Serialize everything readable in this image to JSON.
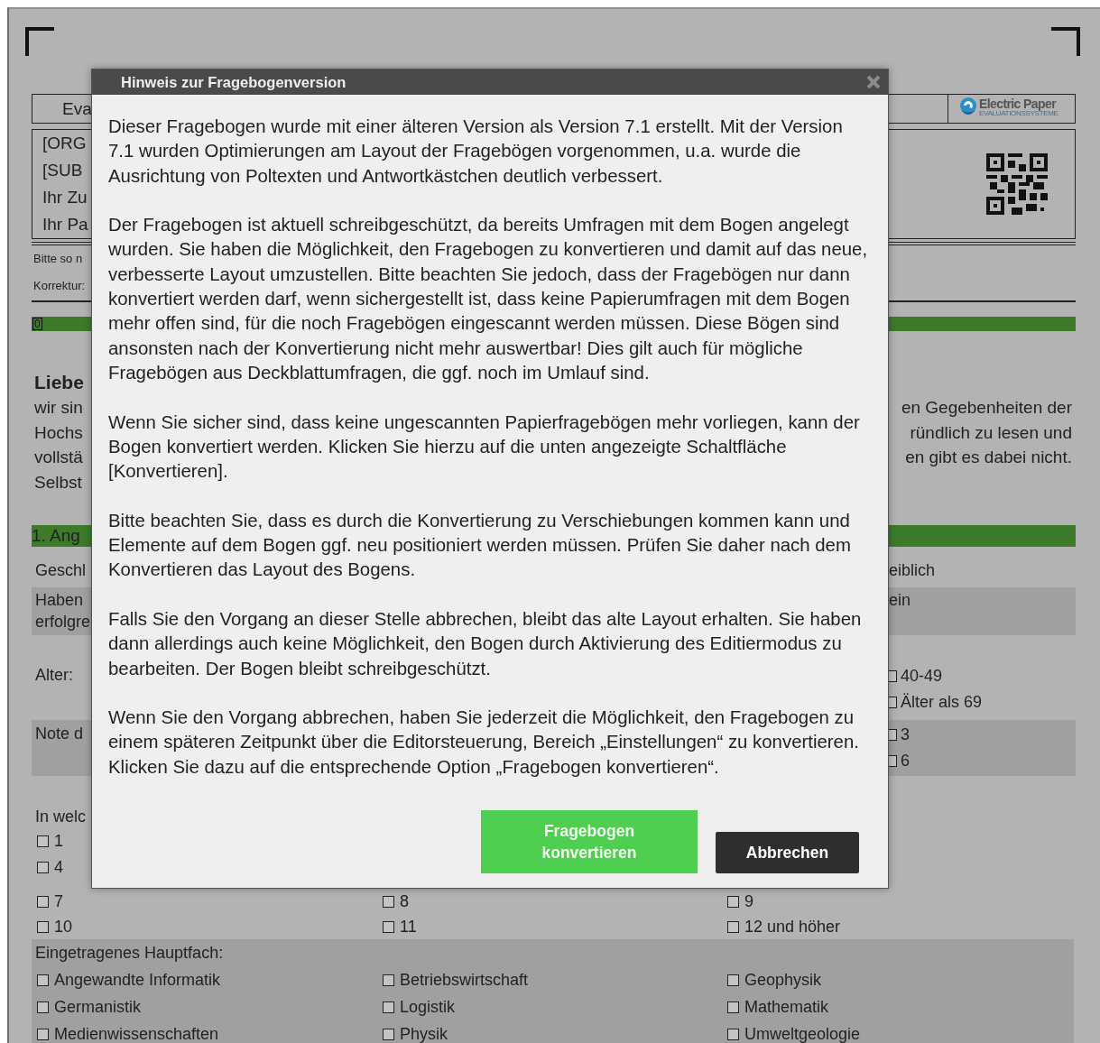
{
  "dialog": {
    "title": "Hinweis zur Fragebogenversion",
    "paragraphs": [
      "Dieser Fragebogen wurde mit einer älteren Version als Version 7.1 erstellt. Mit der Version 7.1 wurden Optimierungen am Layout der Fragebögen vorgenommen, u.a. wurde die Ausrichtung von Poltexten und Antwortkästchen deutlich verbessert.",
      "Der Fragebogen ist aktuell schreibgeschützt, da bereits Umfragen mit dem Bogen angelegt wurden. Sie haben die Möglichkeit, den Fragebogen zu konvertieren und damit auf das neue, verbesserte Layout umzustellen. Bitte beachten Sie jedoch, dass der Fragebögen nur dann konvertiert werden darf, wenn sichergestellt ist, dass keine Papierumfragen mit dem Bogen mehr offen sind, für die noch Fragebögen eingescannt werden müssen. Diese Bögen sind ansonsten nach der Konvertierung nicht mehr auswertbar! Dies gilt auch für mögliche Fragebögen aus Deckblattumfragen, die ggf. noch im Umlauf sind.",
      "Wenn Sie sicher sind, dass keine ungescannten Papierfragebögen mehr vorliegen, kann der Bogen konvertiert werden. Klicken Sie hierzu auf die unten angezeigte Schaltfläche [Konvertieren].",
      "Bitte beachten Sie, dass es durch die Konvertierung zu Verschiebungen kommen kann und Elemente auf dem Bogen ggf. neu positioniert werden müssen. Prüfen Sie daher nach dem Konvertieren das Layout des Bogens.",
      "Falls Sie den Vorgang an dieser Stelle abbrechen, bleibt das alte Layout erhalten. Sie haben dann allerdings auch keine Möglichkeit, den Bogen durch Aktivierung des Editiermodus zu bearbeiten. Der Bogen bleibt schreibgeschützt.",
      "Wenn Sie den Vorgang abbrechen, haben Sie jederzeit die Möglichkeit, den Fragebogen zu einem späteren Zeitpunkt über die Editorsteuerung, Bereich „Einstellungen“ zu konvertieren. Klicken Sie dazu auf die entsprechende Option „Fragebogen konvertieren“."
    ],
    "buttons": [
      {
        "kind": "primary",
        "label": "Fragebogen konvertieren"
      },
      {
        "kind": "secondary",
        "label": "Abbrechen"
      }
    ]
  },
  "form": {
    "header": {
      "title": "Eva"
    },
    "logo": {
      "name": "Electric Paper",
      "tagline": "EVALUATIONSSYSTEME"
    },
    "info_lines": [
      "[ORG",
      "[SUB",
      "Ihr Zu",
      "Ihr Pa"
    ],
    "notes": [
      "Bitte so n",
      "Korrektur:"
    ],
    "progress": {
      "label": "0"
    },
    "greeting": "Liebe",
    "intro_left": [
      "wir sin",
      "Hochs",
      "vollstä",
      "Selbst"
    ],
    "intro_right": [
      "en Gegebenheiten der",
      "ründlich zu lesen und",
      "en gibt es dabei nicht."
    ],
    "section_title": "1. Ang",
    "rows": [
      {
        "shaded": false,
        "left": {
          "lines": [
            "Geschl"
          ]
        },
        "right": {
          "lines": [
            "eiblich"
          ]
        }
      },
      {
        "shaded": true,
        "left": {
          "lines": [
            "Haben",
            "erfolgre"
          ]
        },
        "right": {
          "lines": [
            "ein"
          ]
        }
      },
      {
        "shaded": false,
        "left": {
          "lines": [
            "Alter:"
          ]
        },
        "right": {
          "options": [
            {
              "label": "40-49",
              "checked": false
            },
            {
              "label": "Älter als 69",
              "checked": false
            }
          ]
        }
      },
      {
        "shaded": true,
        "left": {
          "lines": [
            "Note d"
          ]
        },
        "right": {
          "options": [
            {
              "label": "3",
              "checked": false
            },
            {
              "label": "6",
              "checked": false
            }
          ]
        }
      },
      {
        "shaded": false,
        "left": {
          "lines": [
            "In welc"
          ],
          "options": [
            {
              "label": "1",
              "checked": false
            },
            {
              "label": "4",
              "checked": false
            }
          ]
        }
      }
    ],
    "semester_rows": [
      [
        {
          "label": "7",
          "checked": false
        },
        {
          "label": "8",
          "checked": false
        },
        {
          "label": "9",
          "checked": false
        }
      ],
      [
        {
          "label": "10",
          "checked": false
        },
        {
          "label": "11",
          "checked": false
        },
        {
          "label": "12 und höher",
          "checked": false
        }
      ]
    ],
    "subjects": {
      "title": "Eingetragenes Hauptfach:",
      "options": [
        {
          "label": "Angewandte Informatik",
          "checked": false
        },
        {
          "label": "Betriebswirtschaft",
          "checked": false
        },
        {
          "label": "Geophysik",
          "checked": false
        },
        {
          "label": "Germanistik",
          "checked": false
        },
        {
          "label": "Logistik",
          "checked": false
        },
        {
          "label": "Mathematik",
          "checked": false
        },
        {
          "label": "Medienwissenschaften",
          "checked": false
        },
        {
          "label": "Physik",
          "checked": false
        },
        {
          "label": "Umweltgeologie",
          "checked": false
        }
      ]
    }
  }
}
